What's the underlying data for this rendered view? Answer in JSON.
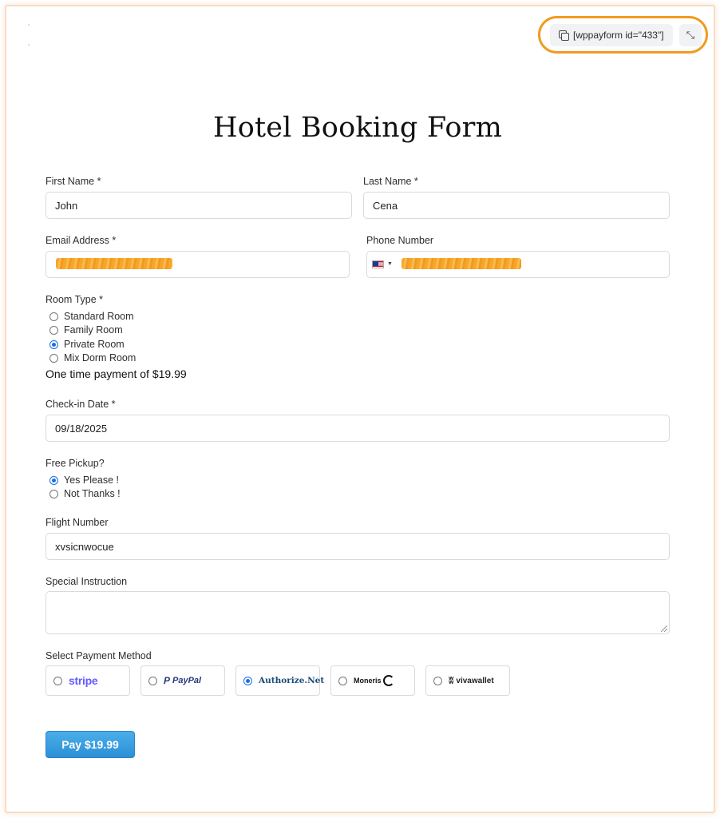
{
  "toolbar": {
    "shortcode_label": "[wppayform id=\"433\"]",
    "collapse_icon": "collapse-icon",
    "copy_icon": "copy-icon",
    "highlight_color": "#f19b1f"
  },
  "form": {
    "title": "Hotel Booking Form",
    "first_name": {
      "label": "First Name *",
      "value": "John"
    },
    "last_name": {
      "label": "Last Name *",
      "value": "Cena"
    },
    "email": {
      "label": "Email Address *",
      "value": ""
    },
    "phone": {
      "label": "Phone Number",
      "value": "",
      "country": "us-flag-icon"
    },
    "room_type": {
      "label": "Room Type *",
      "options": [
        "Standard Room",
        "Family Room",
        "Private Room",
        "Mix Dorm Room"
      ],
      "selected": "Private Room"
    },
    "payment_note": "One time payment of $19.99",
    "checkin": {
      "label": "Check-in Date *",
      "value": "09/18/2025"
    },
    "pickup": {
      "label": "Free Pickup?",
      "options": [
        "Yes Please !",
        "Not Thanks !"
      ],
      "selected": "Yes Please !"
    },
    "flight": {
      "label": "Flight Number",
      "value": "xvsicnwocue"
    },
    "special": {
      "label": "Special Instruction",
      "value": ""
    },
    "payment_method": {
      "label": "Select Payment Method",
      "options": [
        "stripe",
        "PayPal",
        "Authorize.Net",
        "Moneris",
        "vivawallet"
      ],
      "selected": "Authorize.Net"
    },
    "pay_button": "Pay $19.99"
  },
  "colors": {
    "accent": "#1b6fe0",
    "pay_button": "#3a9ee0",
    "stripe": "#635bff",
    "paypal_dark": "#253b80",
    "paypal_light": "#179bd7",
    "redaction": "#f6a21e"
  }
}
